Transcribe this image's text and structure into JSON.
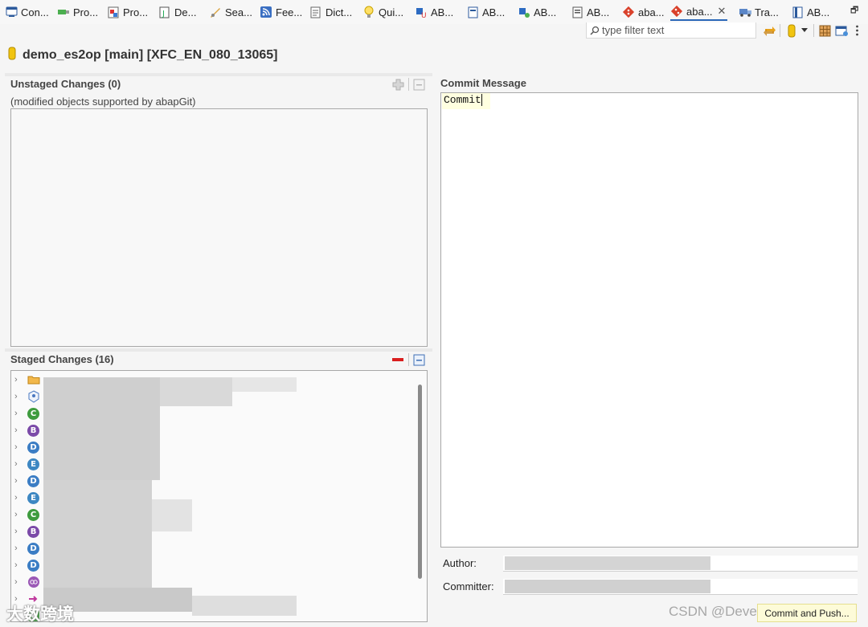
{
  "tabs": [
    {
      "label": "Con...",
      "icon": "console-icon"
    },
    {
      "label": "Pro...",
      "icon": "progress-icon"
    },
    {
      "label": "Pro...",
      "icon": "problems-icon"
    },
    {
      "label": "De...",
      "icon": "debug-icon"
    },
    {
      "label": "Sea...",
      "icon": "search-icon"
    },
    {
      "label": "Fee...",
      "icon": "feed-icon"
    },
    {
      "label": "Dict...",
      "icon": "dictionary-icon"
    },
    {
      "label": "Qui...",
      "icon": "quick-assist-icon"
    },
    {
      "label": "AB...",
      "icon": "abap-unit-icon"
    },
    {
      "label": "AB...",
      "icon": "abap-doc-icon"
    },
    {
      "label": "AB...",
      "icon": "abap-coverage-icon"
    },
    {
      "label": "AB...",
      "icon": "abap-element-info-icon"
    },
    {
      "label": "aba...",
      "icon": "abapgit-repos-icon"
    },
    {
      "label": "aba...",
      "icon": "abapgit-staging-icon",
      "active": true
    },
    {
      "label": "Tra...",
      "icon": "transport-icon"
    },
    {
      "label": "AB...",
      "icon": "abap-language-help-icon"
    }
  ],
  "toolbar": {
    "filter_placeholder": "type filter text"
  },
  "repo_title": "demo_es2op [main] [XFC_EN_080_13065]",
  "unstaged": {
    "title": "Unstaged Changes (0)",
    "subtitle": "(modified objects supported by abapGit)"
  },
  "staged": {
    "title": "Staged Changes (16)",
    "rows": [
      {
        "icon": "folder-icon",
        "letter": ""
      },
      {
        "icon": "package-icon",
        "letter": ""
      },
      {
        "icon": "class-icon",
        "letter": "C"
      },
      {
        "icon": "behavior-icon",
        "letter": "B"
      },
      {
        "icon": "ddic-icon",
        "letter": "D"
      },
      {
        "icon": "entity-icon",
        "letter": "E"
      },
      {
        "icon": "ddic-icon",
        "letter": "D"
      },
      {
        "icon": "entity-icon",
        "letter": "E"
      },
      {
        "icon": "class-icon",
        "letter": "C"
      },
      {
        "icon": "behavior-icon",
        "letter": "B"
      },
      {
        "icon": "ddic-icon",
        "letter": "D"
      },
      {
        "icon": "ddic-icon",
        "letter": "D"
      },
      {
        "icon": "service-binding-icon",
        "letter": ""
      },
      {
        "icon": "arrow-icon",
        "letter": ""
      },
      {
        "icon": "service-definition-icon",
        "letter": ""
      }
    ]
  },
  "commit": {
    "title": "Commit Message",
    "message": "Commit",
    "author_label": "Author:",
    "committer_label": "Committer:",
    "button_label": "Commit and Push..."
  },
  "watermarks": {
    "csdn": "CSDN @Developer_Ang",
    "left": "大数跨境"
  },
  "colors": {
    "active_tab_underline": "#2b67b8",
    "commit_highlight": "#ffffe0"
  }
}
